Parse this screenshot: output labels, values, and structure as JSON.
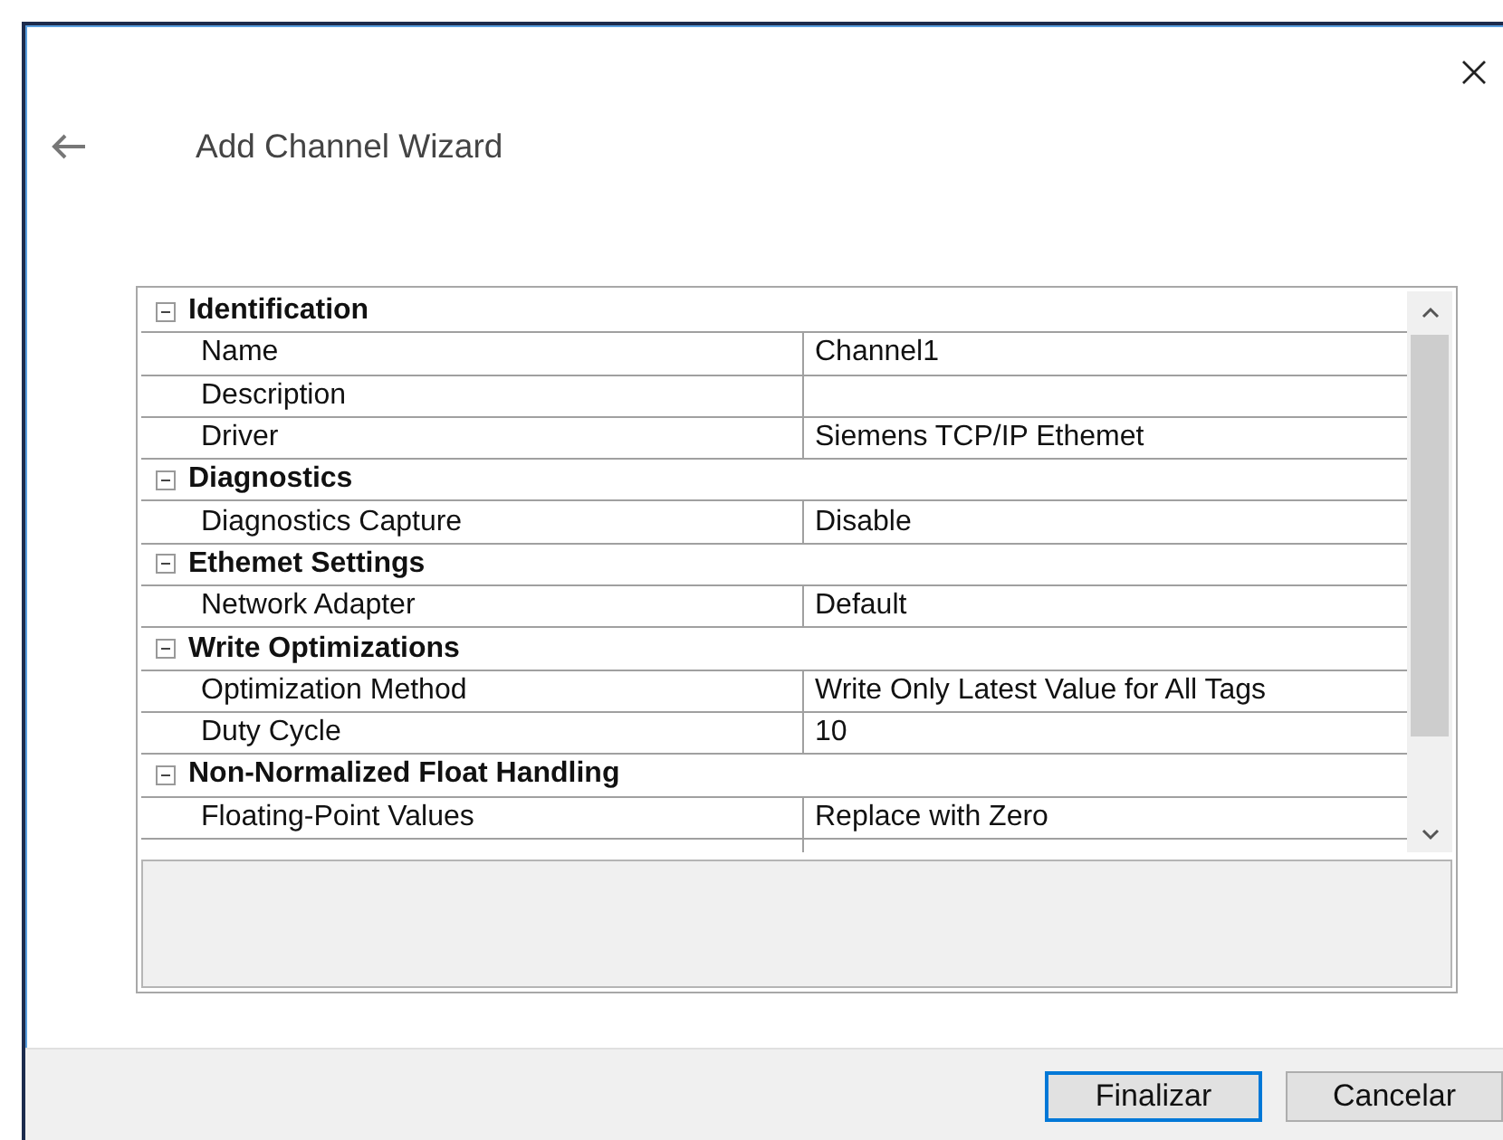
{
  "window": {
    "title": "Add Channel Wizard"
  },
  "sections": [
    {
      "title": "Identification",
      "expanded": true,
      "properties": [
        {
          "name": "Name",
          "value": "Channel1"
        },
        {
          "name": "Description"
        },
        {
          "name": "Driver",
          "value": "Siemens TCP/IP Ethemet"
        }
      ]
    },
    {
      "title": "Diagnostics",
      "expanded": true,
      "properties": [
        {
          "name": "Diagnostics Capture",
          "value": "Disable"
        }
      ]
    },
    {
      "title": "Ethemet Settings",
      "expanded": true,
      "properties": [
        {
          "name": "Network Adapter",
          "value": "Default"
        }
      ]
    },
    {
      "title": "Write Optimizations",
      "expanded": true,
      "properties": [
        {
          "name": "Optimization Method",
          "value": "Write Only Latest Value for All Tags"
        },
        {
          "name": "Duty Cycle",
          "value": "10"
        }
      ]
    },
    {
      "title": "Non-Normalized Float Handling",
      "expanded": true,
      "properties": [
        {
          "name": "Floating-Point Values",
          "value": "Replace with Zero"
        }
      ]
    }
  ],
  "buttons": [
    {
      "label": "Finalizar",
      "selected": true
    },
    {
      "label": "Cancelar",
      "selected": false
    }
  ]
}
